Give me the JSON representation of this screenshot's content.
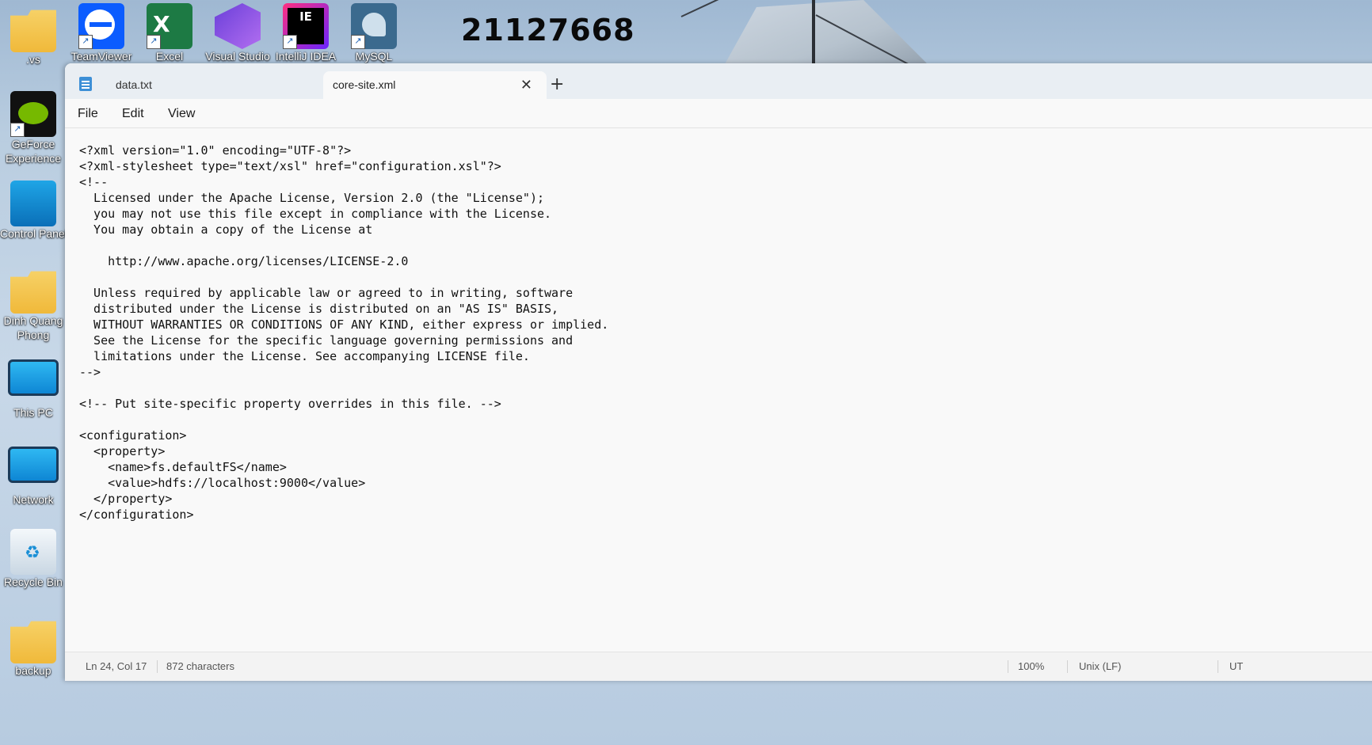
{
  "desktop": {
    "banner_number": "21127668",
    "icons": [
      {
        "name": "vs-folder-icon",
        "label": ".vs"
      },
      {
        "name": "teamviewer-icon",
        "label": "TeamViewer"
      },
      {
        "name": "excel-icon",
        "label": "Excel",
        "glyph": "X"
      },
      {
        "name": "visual-studio-icon",
        "label": "Visual Studio"
      },
      {
        "name": "intellij-idea-icon",
        "label": "IntelliJ IDEA",
        "glyph": "IE"
      },
      {
        "name": "mysql-icon",
        "label": "MySQL"
      },
      {
        "name": "geforce-experience-icon",
        "label": "GeForce\nExperience"
      },
      {
        "name": "control-panel-icon",
        "label": "Control Panel"
      },
      {
        "name": "user-folder-icon",
        "label": "Dinh Quang\nPhong"
      },
      {
        "name": "this-pc-icon",
        "label": "This PC"
      },
      {
        "name": "network-icon",
        "label": "Network"
      },
      {
        "name": "recycle-bin-icon",
        "label": "Recycle Bin"
      },
      {
        "name": "backup-folder-icon",
        "label": "backup"
      }
    ]
  },
  "notepad": {
    "tabs": [
      {
        "label": "data.txt",
        "active": false
      },
      {
        "label": "core-site.xml",
        "active": true
      }
    ],
    "close_glyph": "✕",
    "new_tab_glyph": "+",
    "menu": [
      "File",
      "Edit",
      "View"
    ],
    "content": "<?xml version=\"1.0\" encoding=\"UTF-8\"?>\n<?xml-stylesheet type=\"text/xsl\" href=\"configuration.xsl\"?>\n<!--\n  Licensed under the Apache License, Version 2.0 (the \"License\");\n  you may not use this file except in compliance with the License.\n  You may obtain a copy of the License at\n\n    http://www.apache.org/licenses/LICENSE-2.0\n\n  Unless required by applicable law or agreed to in writing, software\n  distributed under the License is distributed on an \"AS IS\" BASIS,\n  WITHOUT WARRANTIES OR CONDITIONS OF ANY KIND, either express or implied.\n  See the License for the specific language governing permissions and\n  limitations under the License. See accompanying LICENSE file.\n-->\n\n<!-- Put site-specific property overrides in this file. -->\n\n<configuration>\n  <property>\n    <name>fs.defaultFS</name>\n    <value>hdfs://localhost:9000</value>\n  </property>\n</configuration>",
    "status": {
      "position": "Ln 24, Col 17",
      "characters": "872 characters",
      "zoom": "100%",
      "line_ending": "Unix (LF)",
      "encoding": "UT"
    }
  }
}
